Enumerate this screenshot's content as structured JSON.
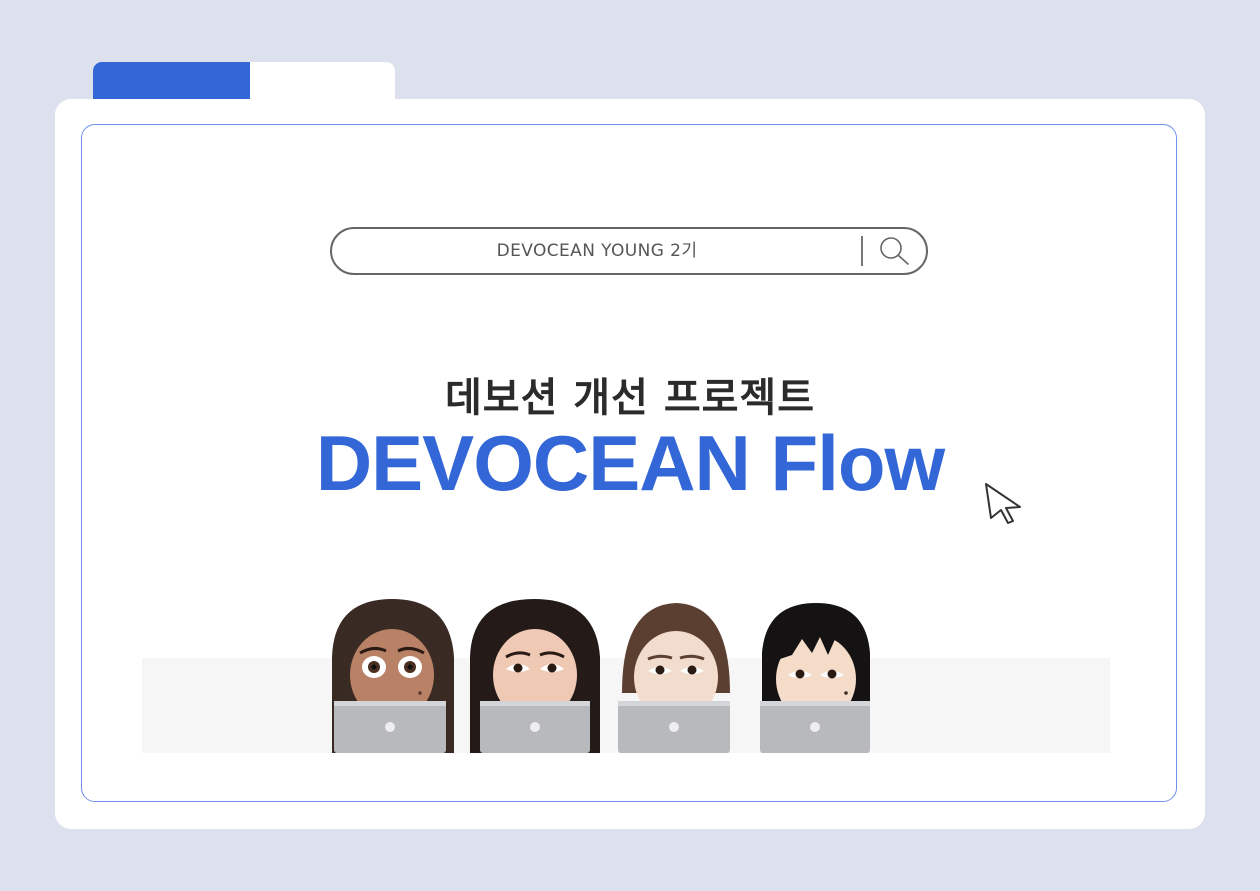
{
  "search": {
    "query": "DEVOCEAN YOUNG 2기"
  },
  "hero": {
    "subtitle": "데보션 개선 프로젝트",
    "title": "DEVOCEAN Flow"
  },
  "colors": {
    "accent": "#3366d6",
    "background": "#dde1ee",
    "frame_border": "#6f93ea"
  },
  "icons": {
    "search": "search-icon",
    "cursor": "cursor-arrow-icon",
    "laptop_logo": "apple-logo-icon"
  },
  "team": [
    {
      "avatar": "memoji-1",
      "hair": "#3a2a24",
      "skin": "#b98266"
    },
    {
      "avatar": "memoji-2",
      "hair": "#241a18",
      "skin": "#f0c9b5"
    },
    {
      "avatar": "memoji-3",
      "hair": "#5b4032",
      "skin": "#f2dccd"
    },
    {
      "avatar": "memoji-4",
      "hair": "#141212",
      "skin": "#f4dcc9"
    }
  ]
}
